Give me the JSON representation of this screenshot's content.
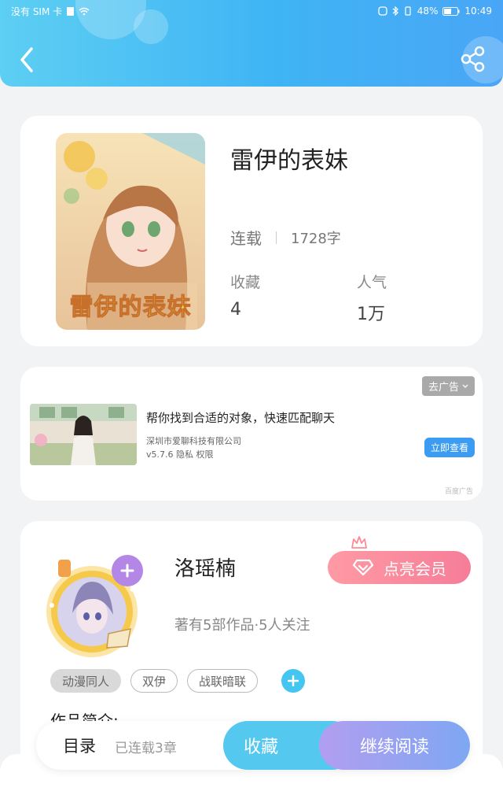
{
  "status_bar": {
    "carrier": "没有 SIM 卡",
    "battery": "48%",
    "time": "10:49"
  },
  "header": {
    "back_icon": "chevron-left-icon",
    "share_icon": "share-icon"
  },
  "book": {
    "title": "雷伊的表妹",
    "cover_text": "雷伊的表妹",
    "status": "连载",
    "word_count": "1728字",
    "favorites_label": "收藏",
    "favorites_value": "4",
    "popularity_label": "人气",
    "popularity_value": "1万"
  },
  "ad": {
    "remove_label": "去广告",
    "headline": "帮你找到合适的对象，快速匹配聊天",
    "company": "深圳市爱聊科技有限公司",
    "meta": "v5.7.6  隐私  权限",
    "cta": "立即查看",
    "source": "百度广告"
  },
  "author": {
    "name": "洛瑶楠",
    "stats": "著有5部作品·5人关注",
    "vip_label": "点亮会员",
    "tags": [
      "动漫同人",
      "双伊",
      "战联暗联"
    ],
    "intro_heading": "作品简介:"
  },
  "bottom_bar": {
    "toc_label": "目录",
    "chapters": "已连载3章",
    "favorite_label": "收藏",
    "read_label": "继续阅读"
  },
  "colors": {
    "header": "#3fb4f4",
    "accent": "#45c6f0",
    "vip": "#f67d98",
    "read_btn": "#9ea4f1"
  }
}
